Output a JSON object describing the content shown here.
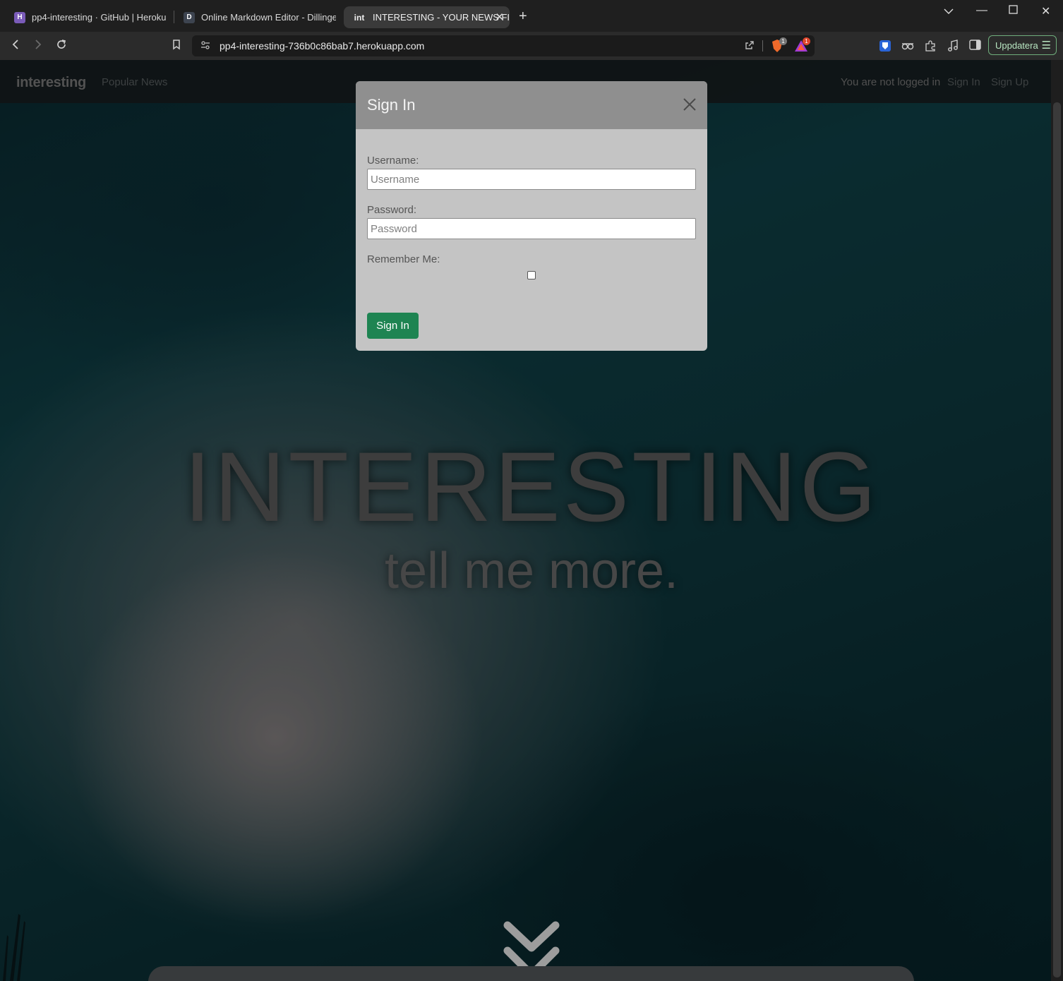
{
  "browser": {
    "tabs": [
      {
        "title": "pp4-interesting · GitHub | Heroku",
        "favicon": "H"
      },
      {
        "title": "Online Markdown Editor - Dillinger,",
        "favicon": "D"
      },
      {
        "title": "INTERESTING - YOUR NEWS FIX",
        "favicon": "int"
      }
    ],
    "url": "pp4-interesting-736b0c86bab7.herokuapp.com",
    "update_label": "Uppdatera",
    "badges": {
      "brave": "1",
      "rewards": "1"
    }
  },
  "site": {
    "brand": "interesting",
    "nav_popular": "Popular News",
    "login_status": "You are not logged in",
    "nav_signin": "Sign In",
    "nav_signup": "Sign Up",
    "hero_title": "INTERESTING",
    "hero_subtitle": "tell me more."
  },
  "modal": {
    "title": "Sign In",
    "username_label": "Username:",
    "username_placeholder": "Username",
    "password_label": "Password:",
    "password_placeholder": "Password",
    "remember_label": "Remember Me:",
    "remember_checked": false,
    "submit_label": "Sign In"
  },
  "colors": {
    "accent_green": "#1e8452",
    "modal_header": "#8f8f8f",
    "modal_body": "#c4c4c4"
  }
}
